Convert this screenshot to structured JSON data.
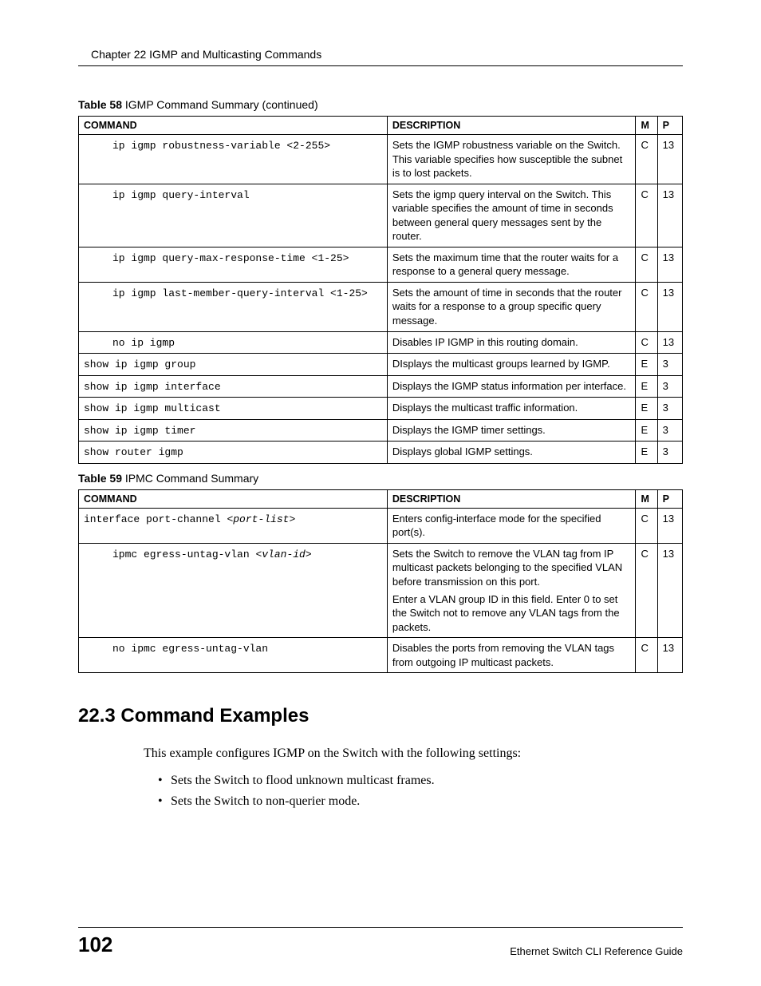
{
  "header": {
    "chapter_line": "Chapter 22 IGMP and Multicasting Commands"
  },
  "table58": {
    "caption_label": "Table 58",
    "caption_text": "IGMP Command Summary  (continued)",
    "headers": {
      "command": "COMMAND",
      "description": "DESCRIPTION",
      "m": "M",
      "p": "P"
    },
    "rows": [
      {
        "cmd": "ip igmp robustness-variable <2-255>",
        "indent": "indent1",
        "desc": [
          "Sets the IGMP robustness variable on the Switch. This variable specifies how susceptible the subnet is to lost packets."
        ],
        "m": "C",
        "p": "13"
      },
      {
        "cmd": "ip igmp query-interval",
        "indent": "indent1",
        "desc": [
          "Sets the igmp query interval on the Switch. This variable specifies the amount of time in seconds between general query messages sent by the router."
        ],
        "m": "C",
        "p": "13"
      },
      {
        "cmd": "ip igmp query-max-response-time <1-25>",
        "indent": "indent1",
        "desc": [
          "Sets the maximum time that the router waits for a response to a general query message."
        ],
        "m": "C",
        "p": "13"
      },
      {
        "cmd": "ip igmp last-member-query-interval <1-25>",
        "indent": "indent1",
        "desc": [
          "Sets the amount of time in seconds that the router waits for a response to a group specific query message."
        ],
        "m": "C",
        "p": "13"
      },
      {
        "cmd": "no ip igmp",
        "indent": "indent1",
        "desc": [
          "Disables IP IGMP in this routing domain."
        ],
        "m": "C",
        "p": "13"
      },
      {
        "cmd": "show ip igmp group",
        "indent": "indent0",
        "desc": [
          "DIsplays the multicast groups learned by IGMP."
        ],
        "m": "E",
        "p": "3"
      },
      {
        "cmd": "show ip igmp interface",
        "indent": "indent0",
        "desc": [
          "Displays the IGMP status information per interface."
        ],
        "m": "E",
        "p": "3"
      },
      {
        "cmd": "show ip igmp multicast",
        "indent": "indent0",
        "desc": [
          "Displays the multicast traffic information."
        ],
        "m": "E",
        "p": "3"
      },
      {
        "cmd": "show ip igmp timer",
        "indent": "indent0",
        "desc": [
          "Displays the IGMP timer settings."
        ],
        "m": "E",
        "p": "3"
      },
      {
        "cmd": "show router igmp",
        "indent": "indent0",
        "desc": [
          "Displays global IGMP settings."
        ],
        "m": "E",
        "p": "3"
      }
    ]
  },
  "table59": {
    "caption_label": "Table 59",
    "caption_text": "IPMC Command Summary",
    "headers": {
      "command": "COMMAND",
      "description": "DESCRIPTION",
      "m": "M",
      "p": "P"
    },
    "rows": [
      {
        "cmd_plain": "interface port-channel ",
        "cmd_italic": "<port-list>",
        "indent": "indent0",
        "desc": [
          "Enters config-interface mode for the specified port(s)."
        ],
        "m": "C",
        "p": "13"
      },
      {
        "cmd_plain": "ipmc egress-untag-vlan ",
        "cmd_italic": "<vlan-id>",
        "indent": "indent1",
        "desc": [
          "Sets the Switch to remove the VLAN tag from IP multicast packets belonging to the specified VLAN before transmission on this port.",
          "Enter a VLAN group ID in this field. Enter 0 to set the Switch not to remove any VLAN tags from the packets."
        ],
        "m": "C",
        "p": "13"
      },
      {
        "cmd_plain": "no ipmc egress-untag-vlan",
        "cmd_italic": "",
        "indent": "indent1",
        "desc": [
          "Disables the ports from removing the VLAN tags from outgoing IP multicast packets."
        ],
        "m": "C",
        "p": "13"
      }
    ]
  },
  "section": {
    "heading": "22.3  Command Examples",
    "intro": "This example configures IGMP on the Switch with the following settings:",
    "bullets": [
      "Sets the Switch to flood unknown multicast frames.",
      "Sets the Switch to non-querier mode."
    ]
  },
  "footer": {
    "page_number": "102",
    "guide_name": "Ethernet Switch CLI Reference Guide"
  }
}
